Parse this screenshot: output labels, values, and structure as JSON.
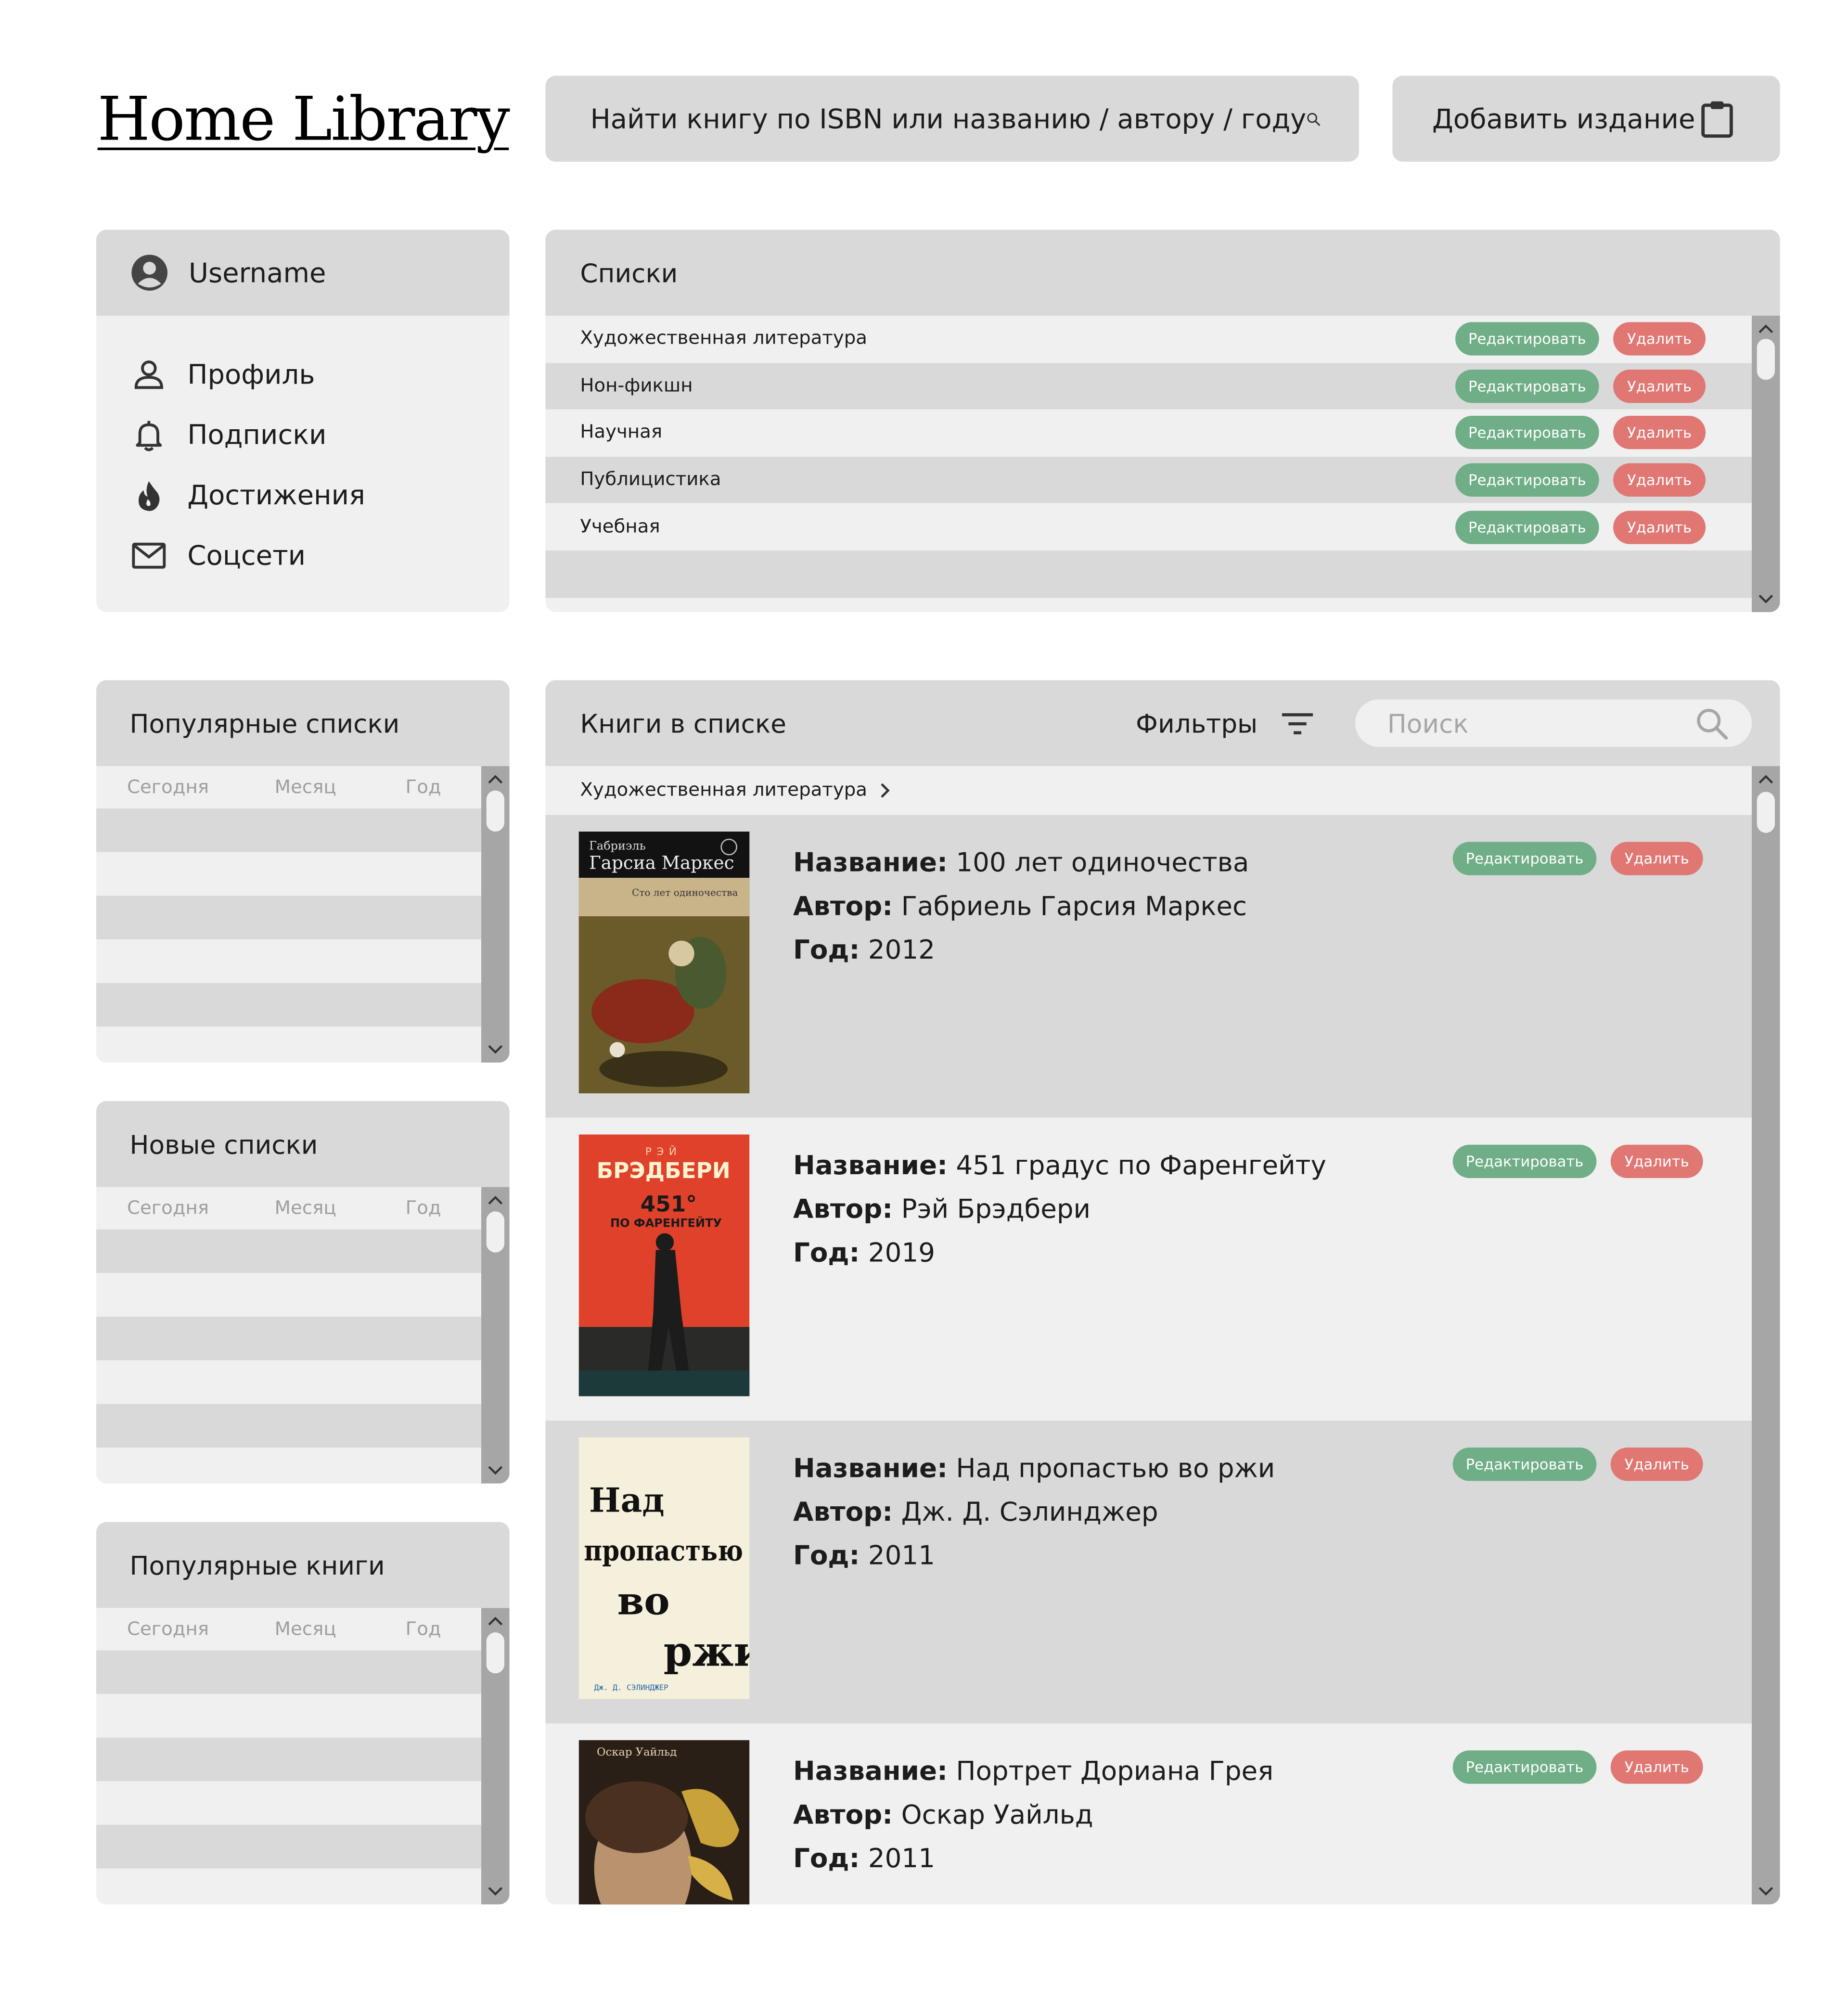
{
  "header": {
    "logo": "Home Library",
    "search_text": "Найти книгу по ISBN или названию / автору / году",
    "add_label": "Добавить издание"
  },
  "user": {
    "name": "Username",
    "menu": [
      {
        "label": "Профиль",
        "icon": "person-icon"
      },
      {
        "label": "Подписки",
        "icon": "bell-icon"
      },
      {
        "label": "Достижения",
        "icon": "flame-icon"
      },
      {
        "label": "Соцсети",
        "icon": "mail-icon"
      }
    ]
  },
  "lists": {
    "title": "Списки",
    "edit_label": "Редактировать",
    "delete_label": "Удалить",
    "items": [
      "Художественная литература",
      "Нон-фикшн",
      "Научная",
      "Публицистика",
      "Учебная"
    ]
  },
  "side_panels": [
    {
      "title": "Популярные списки",
      "tabs": [
        "Сегодня",
        "Месяц",
        "Год"
      ]
    },
    {
      "title": "Новые списки",
      "tabs": [
        "Сегодня",
        "Месяц",
        "Год"
      ]
    },
    {
      "title": "Популярные книги",
      "tabs": [
        "Сегодня",
        "Месяц",
        "Год"
      ]
    }
  ],
  "books_panel": {
    "title": "Книги в списке",
    "filters_label": "Фильтры",
    "search_placeholder": "Поиск",
    "breadcrumb": "Художественная литература",
    "labels": {
      "title": "Название:",
      "author": "Автор:",
      "year": "Год:"
    },
    "books": [
      {
        "title": "100 лет одиночества",
        "author": "Габриель Гарсия Маркес",
        "year": "2012",
        "cover": {
          "top_line1": "Габриэль",
          "top_line2": "Гарсиа Маркес",
          "subtitle": "Сто лет одиночества"
        }
      },
      {
        "title": "451 градус по Фаренгейту",
        "author": "Рэй Брэдбери",
        "year": "2019",
        "cover": {
          "top_line1": "РЭЙ",
          "top_line2": "БРЭДБЕРИ",
          "subtitle": "451°",
          "sub2": "ПО ФАРЕНГЕЙТУ"
        }
      },
      {
        "title": "Над пропастью во ржи",
        "author": "Дж. Д. Сэлинджер",
        "year": "2011",
        "cover": {
          "l1": "Над",
          "l2": "пропастью",
          "l3": "во",
          "l4": "ржи",
          "author": "Дж. Д. СЭЛИНДЖЕР"
        }
      },
      {
        "title": "Портрет Дориана Грея",
        "author": "Оскар Уайльд",
        "year": "2011",
        "cover": {
          "author": "Оскар Уайльд"
        }
      }
    ]
  },
  "colors": {
    "panel_dark": "#d9d9d9",
    "panel_light": "#f0f0f0",
    "edit": "#6fae86",
    "delete": "#e07773",
    "scrollbar": "#a6a6a6"
  }
}
